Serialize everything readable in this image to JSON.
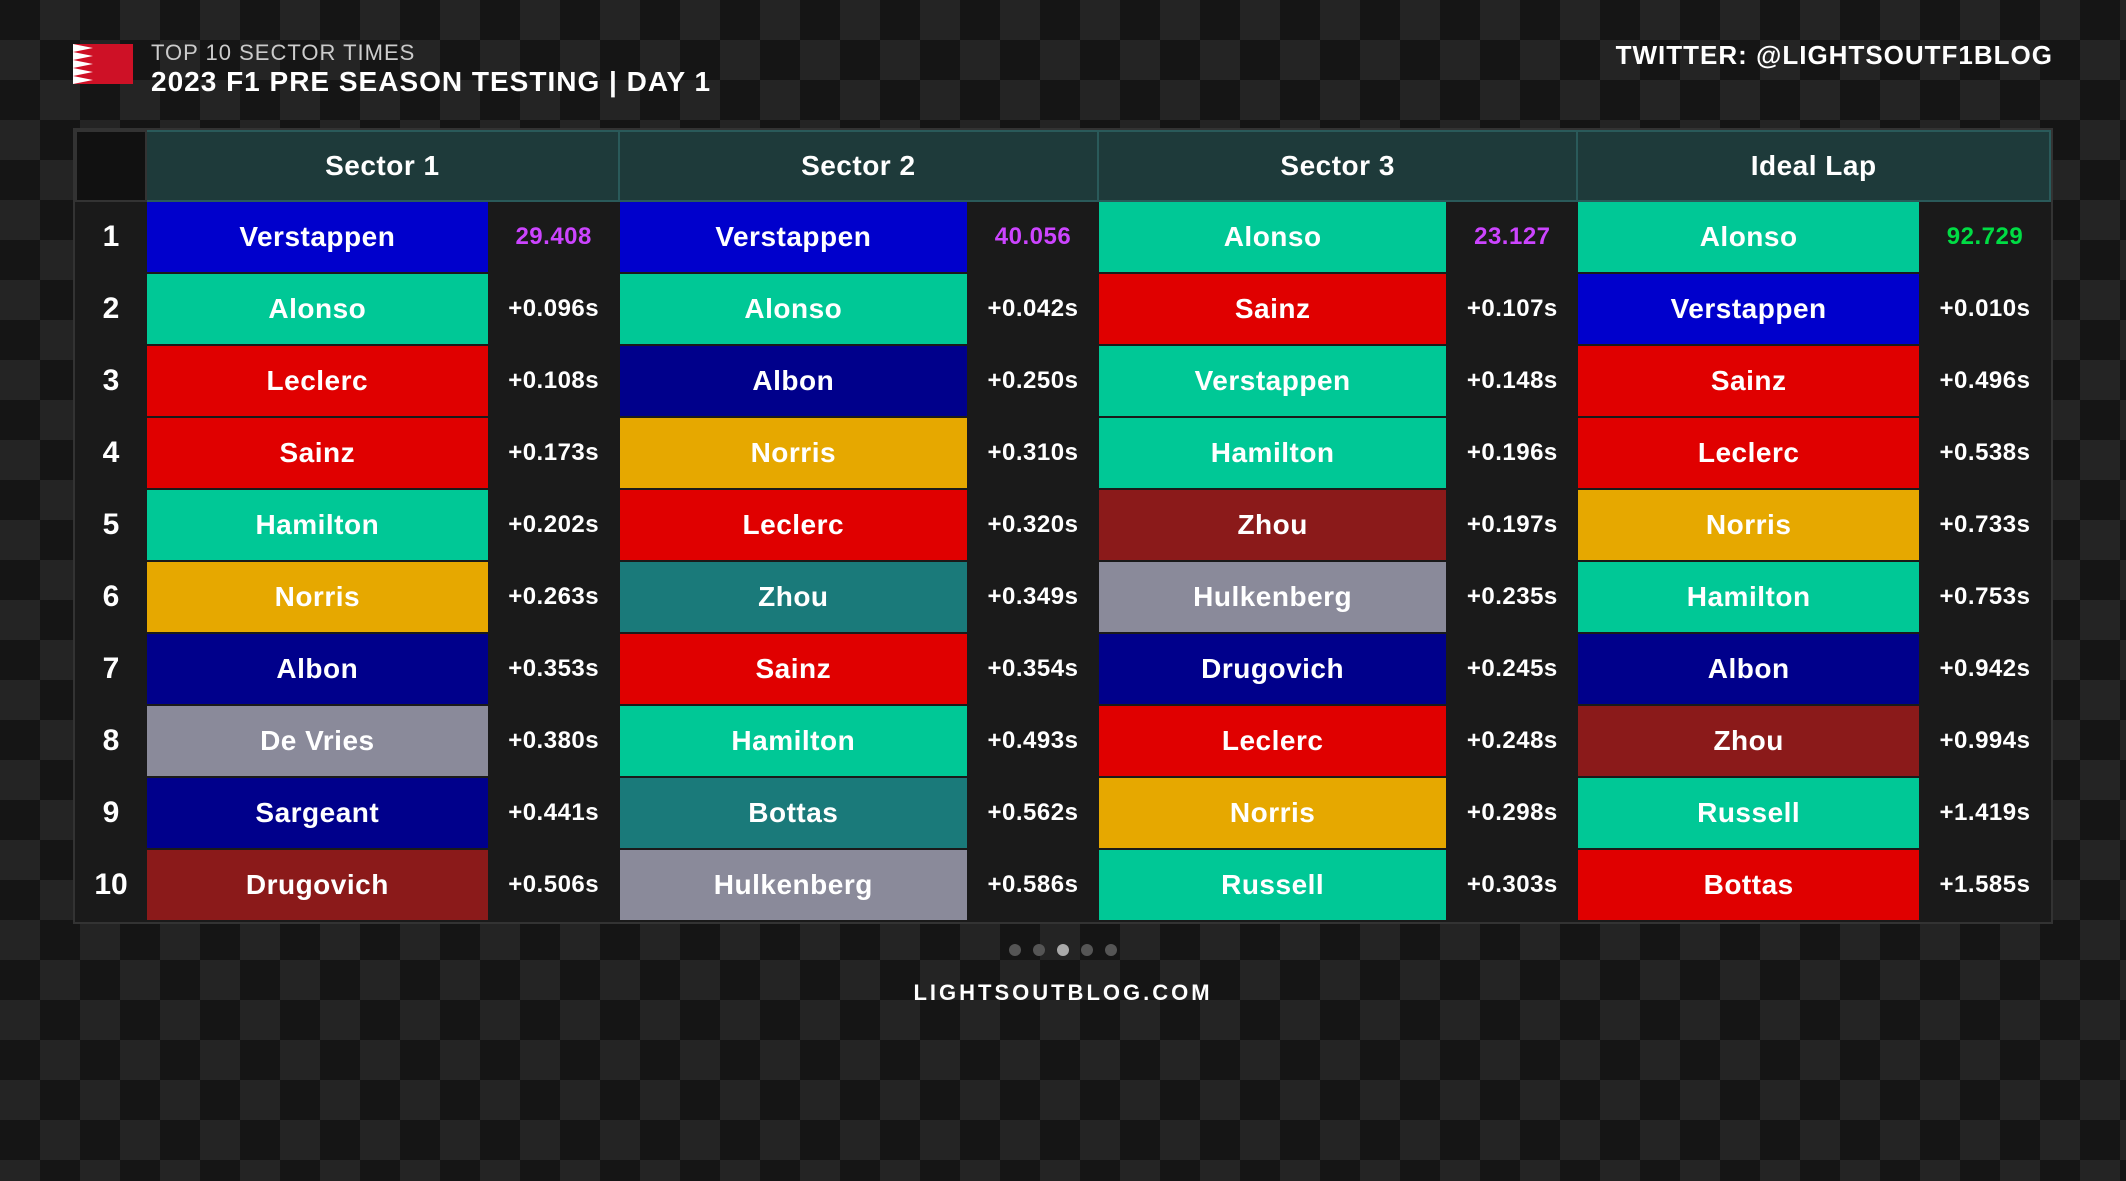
{
  "header": {
    "subtitle": "TOP 10 SECTOR TIMES",
    "title": "2023 F1 PRE SEASON TESTING | DAY 1",
    "twitter_label": "TWITTER: ",
    "twitter_handle": "@LIGHTSOUTF1BLOG"
  },
  "columns": [
    "Sector 1",
    "Sector 2",
    "Sector 3",
    "Ideal Lap"
  ],
  "rows": [
    {
      "rank": "1",
      "s1_name": "Verstappen",
      "s1_color": "bg-blue",
      "s1_time": "29.408",
      "s1_time_color": "time-purple",
      "s2_name": "Verstappen",
      "s2_color": "bg-blue",
      "s2_time": "40.056",
      "s2_time_color": "time-purple",
      "s3_name": "Alonso",
      "s3_color": "bg-green",
      "s3_time": "23.127",
      "s3_time_color": "time-purple",
      "il_name": "Alonso",
      "il_color": "bg-green",
      "il_time": "92.729",
      "il_time_color": "time-green"
    },
    {
      "rank": "2",
      "s1_name": "Alonso",
      "s1_color": "bg-green",
      "s1_time": "+0.096s",
      "s1_time_color": "time-white",
      "s2_name": "Alonso",
      "s2_color": "bg-green",
      "s2_time": "+0.042s",
      "s2_time_color": "time-white",
      "s3_name": "Sainz",
      "s3_color": "bg-red",
      "s3_time": "+0.107s",
      "s3_time_color": "time-white",
      "il_name": "Verstappen",
      "il_color": "bg-blue",
      "il_time": "+0.010s",
      "il_time_color": "time-white"
    },
    {
      "rank": "3",
      "s1_name": "Leclerc",
      "s1_color": "bg-red",
      "s1_time": "+0.108s",
      "s1_time_color": "time-white",
      "s2_name": "Albon",
      "s2_color": "bg-dark-blue",
      "s2_time": "+0.250s",
      "s2_time_color": "time-white",
      "s3_name": "Verstappen",
      "s3_color": "bg-green",
      "s3_time": "+0.148s",
      "s3_time_color": "time-white",
      "il_name": "Sainz",
      "il_color": "bg-red",
      "il_time": "+0.496s",
      "il_time_color": "time-white"
    },
    {
      "rank": "4",
      "s1_name": "Sainz",
      "s1_color": "bg-red",
      "s1_time": "+0.173s",
      "s1_time_color": "time-white",
      "s2_name": "Norris",
      "s2_color": "bg-gold",
      "s2_time": "+0.310s",
      "s2_time_color": "time-white",
      "s3_name": "Hamilton",
      "s3_color": "bg-green",
      "s3_time": "+0.196s",
      "s3_time_color": "time-white",
      "il_name": "Leclerc",
      "il_color": "bg-red",
      "il_time": "+0.538s",
      "il_time_color": "time-white"
    },
    {
      "rank": "5",
      "s1_name": "Hamilton",
      "s1_color": "bg-green",
      "s1_time": "+0.202s",
      "s1_time_color": "time-white",
      "s2_name": "Leclerc",
      "s2_color": "bg-red",
      "s2_time": "+0.320s",
      "s2_time_color": "time-white",
      "s3_name": "Zhou",
      "s3_color": "bg-dark-red",
      "s3_time": "+0.197s",
      "s3_time_color": "time-white",
      "il_name": "Norris",
      "il_color": "bg-gold",
      "il_time": "+0.733s",
      "il_time_color": "time-white"
    },
    {
      "rank": "6",
      "s1_name": "Norris",
      "s1_color": "bg-gold",
      "s1_time": "+0.263s",
      "s1_time_color": "time-white",
      "s2_name": "Zhou",
      "s2_color": "bg-teal",
      "s2_time": "+0.349s",
      "s2_time_color": "time-white",
      "s3_name": "Hulkenberg",
      "s3_color": "bg-gray",
      "s3_time": "+0.235s",
      "s3_time_color": "time-white",
      "il_name": "Hamilton",
      "il_color": "bg-green",
      "il_time": "+0.753s",
      "il_time_color": "time-white"
    },
    {
      "rank": "7",
      "s1_name": "Albon",
      "s1_color": "bg-dark-blue",
      "s1_time": "+0.353s",
      "s1_time_color": "time-white",
      "s2_name": "Sainz",
      "s2_color": "bg-red",
      "s2_time": "+0.354s",
      "s2_time_color": "time-white",
      "s3_name": "Drugovich",
      "s3_color": "bg-dark-blue",
      "s3_time": "+0.245s",
      "s3_time_color": "time-white",
      "il_name": "Albon",
      "il_color": "bg-dark-blue",
      "il_time": "+0.942s",
      "il_time_color": "time-white"
    },
    {
      "rank": "8",
      "s1_name": "De Vries",
      "s1_color": "bg-gray",
      "s1_time": "+0.380s",
      "s1_time_color": "time-white",
      "s2_name": "Hamilton",
      "s2_color": "bg-green",
      "s2_time": "+0.493s",
      "s2_time_color": "time-white",
      "s3_name": "Leclerc",
      "s3_color": "bg-red",
      "s3_time": "+0.248s",
      "s3_time_color": "time-white",
      "il_name": "Zhou",
      "il_color": "bg-dark-red",
      "il_time": "+0.994s",
      "il_time_color": "time-white"
    },
    {
      "rank": "9",
      "s1_name": "Sargeant",
      "s1_color": "bg-dark-blue",
      "s1_time": "+0.441s",
      "s1_time_color": "time-white",
      "s2_name": "Bottas",
      "s2_color": "bg-teal",
      "s2_time": "+0.562s",
      "s2_time_color": "time-white",
      "s3_name": "Norris",
      "s3_color": "bg-gold",
      "s3_time": "+0.298s",
      "s3_time_color": "time-white",
      "il_name": "Russell",
      "il_color": "bg-green",
      "il_time": "+1.419s",
      "il_time_color": "time-white"
    },
    {
      "rank": "10",
      "s1_name": "Drugovich",
      "s1_color": "bg-dark-red",
      "s1_time": "+0.506s",
      "s1_time_color": "time-white",
      "s2_name": "Hulkenberg",
      "s2_color": "bg-gray",
      "s2_time": "+0.586s",
      "s2_time_color": "time-white",
      "s3_name": "Russell",
      "s3_color": "bg-green",
      "s3_time": "+0.303s",
      "s3_time_color": "time-white",
      "il_name": "Bottas",
      "il_color": "bg-red",
      "il_time": "+1.585s",
      "il_time_color": "time-white"
    }
  ],
  "footer": {
    "url": "LIGHTSOUTBLOG.COM",
    "dots": [
      false,
      false,
      true,
      false,
      false
    ]
  }
}
